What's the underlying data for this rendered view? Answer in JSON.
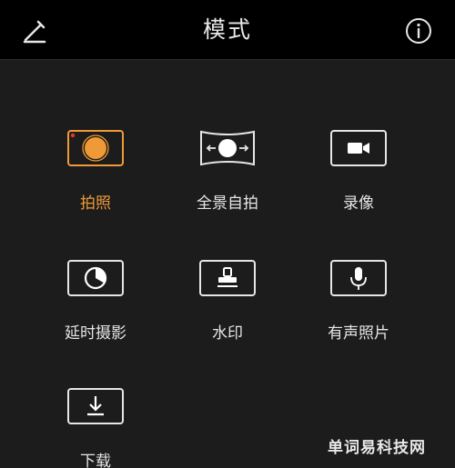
{
  "header": {
    "title": "模式",
    "edit_icon": "pencil-icon",
    "info_icon": "info-icon"
  },
  "modes": [
    {
      "label": "拍照",
      "icon": "shutter-icon",
      "active": true
    },
    {
      "label": "全景自拍",
      "icon": "panorama-icon",
      "active": false
    },
    {
      "label": "录像",
      "icon": "video-camera-icon",
      "active": false
    },
    {
      "label": "延时摄影",
      "icon": "timelapse-icon",
      "active": false
    },
    {
      "label": "水印",
      "icon": "stamp-icon",
      "active": false
    },
    {
      "label": "有声照片",
      "icon": "microphone-icon",
      "active": false
    },
    {
      "label": "下载",
      "icon": "download-icon",
      "active": false
    }
  ],
  "watermark": "单词易科技网",
  "colors": {
    "accent": "#f09a37",
    "accent_dot": "#e0392b",
    "background": "#1c1c1c",
    "header_bg": "#000000",
    "icon_stroke": "#e6e6e6"
  }
}
